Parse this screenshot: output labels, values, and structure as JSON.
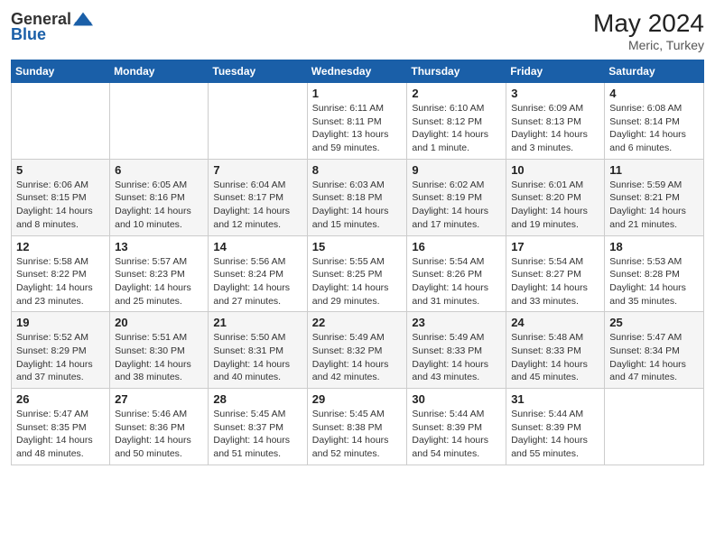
{
  "header": {
    "logo_line1": "General",
    "logo_line2": "Blue",
    "month_year": "May 2024",
    "location": "Meric, Turkey"
  },
  "days_of_week": [
    "Sunday",
    "Monday",
    "Tuesday",
    "Wednesday",
    "Thursday",
    "Friday",
    "Saturday"
  ],
  "weeks": [
    [
      {
        "num": "",
        "sunrise": "",
        "sunset": "",
        "daylight": ""
      },
      {
        "num": "",
        "sunrise": "",
        "sunset": "",
        "daylight": ""
      },
      {
        "num": "",
        "sunrise": "",
        "sunset": "",
        "daylight": ""
      },
      {
        "num": "1",
        "sunrise": "Sunrise: 6:11 AM",
        "sunset": "Sunset: 8:11 PM",
        "daylight": "Daylight: 13 hours and 59 minutes."
      },
      {
        "num": "2",
        "sunrise": "Sunrise: 6:10 AM",
        "sunset": "Sunset: 8:12 PM",
        "daylight": "Daylight: 14 hours and 1 minute."
      },
      {
        "num": "3",
        "sunrise": "Sunrise: 6:09 AM",
        "sunset": "Sunset: 8:13 PM",
        "daylight": "Daylight: 14 hours and 3 minutes."
      },
      {
        "num": "4",
        "sunrise": "Sunrise: 6:08 AM",
        "sunset": "Sunset: 8:14 PM",
        "daylight": "Daylight: 14 hours and 6 minutes."
      }
    ],
    [
      {
        "num": "5",
        "sunrise": "Sunrise: 6:06 AM",
        "sunset": "Sunset: 8:15 PM",
        "daylight": "Daylight: 14 hours and 8 minutes."
      },
      {
        "num": "6",
        "sunrise": "Sunrise: 6:05 AM",
        "sunset": "Sunset: 8:16 PM",
        "daylight": "Daylight: 14 hours and 10 minutes."
      },
      {
        "num": "7",
        "sunrise": "Sunrise: 6:04 AM",
        "sunset": "Sunset: 8:17 PM",
        "daylight": "Daylight: 14 hours and 12 minutes."
      },
      {
        "num": "8",
        "sunrise": "Sunrise: 6:03 AM",
        "sunset": "Sunset: 8:18 PM",
        "daylight": "Daylight: 14 hours and 15 minutes."
      },
      {
        "num": "9",
        "sunrise": "Sunrise: 6:02 AM",
        "sunset": "Sunset: 8:19 PM",
        "daylight": "Daylight: 14 hours and 17 minutes."
      },
      {
        "num": "10",
        "sunrise": "Sunrise: 6:01 AM",
        "sunset": "Sunset: 8:20 PM",
        "daylight": "Daylight: 14 hours and 19 minutes."
      },
      {
        "num": "11",
        "sunrise": "Sunrise: 5:59 AM",
        "sunset": "Sunset: 8:21 PM",
        "daylight": "Daylight: 14 hours and 21 minutes."
      }
    ],
    [
      {
        "num": "12",
        "sunrise": "Sunrise: 5:58 AM",
        "sunset": "Sunset: 8:22 PM",
        "daylight": "Daylight: 14 hours and 23 minutes."
      },
      {
        "num": "13",
        "sunrise": "Sunrise: 5:57 AM",
        "sunset": "Sunset: 8:23 PM",
        "daylight": "Daylight: 14 hours and 25 minutes."
      },
      {
        "num": "14",
        "sunrise": "Sunrise: 5:56 AM",
        "sunset": "Sunset: 8:24 PM",
        "daylight": "Daylight: 14 hours and 27 minutes."
      },
      {
        "num": "15",
        "sunrise": "Sunrise: 5:55 AM",
        "sunset": "Sunset: 8:25 PM",
        "daylight": "Daylight: 14 hours and 29 minutes."
      },
      {
        "num": "16",
        "sunrise": "Sunrise: 5:54 AM",
        "sunset": "Sunset: 8:26 PM",
        "daylight": "Daylight: 14 hours and 31 minutes."
      },
      {
        "num": "17",
        "sunrise": "Sunrise: 5:54 AM",
        "sunset": "Sunset: 8:27 PM",
        "daylight": "Daylight: 14 hours and 33 minutes."
      },
      {
        "num": "18",
        "sunrise": "Sunrise: 5:53 AM",
        "sunset": "Sunset: 8:28 PM",
        "daylight": "Daylight: 14 hours and 35 minutes."
      }
    ],
    [
      {
        "num": "19",
        "sunrise": "Sunrise: 5:52 AM",
        "sunset": "Sunset: 8:29 PM",
        "daylight": "Daylight: 14 hours and 37 minutes."
      },
      {
        "num": "20",
        "sunrise": "Sunrise: 5:51 AM",
        "sunset": "Sunset: 8:30 PM",
        "daylight": "Daylight: 14 hours and 38 minutes."
      },
      {
        "num": "21",
        "sunrise": "Sunrise: 5:50 AM",
        "sunset": "Sunset: 8:31 PM",
        "daylight": "Daylight: 14 hours and 40 minutes."
      },
      {
        "num": "22",
        "sunrise": "Sunrise: 5:49 AM",
        "sunset": "Sunset: 8:32 PM",
        "daylight": "Daylight: 14 hours and 42 minutes."
      },
      {
        "num": "23",
        "sunrise": "Sunrise: 5:49 AM",
        "sunset": "Sunset: 8:33 PM",
        "daylight": "Daylight: 14 hours and 43 minutes."
      },
      {
        "num": "24",
        "sunrise": "Sunrise: 5:48 AM",
        "sunset": "Sunset: 8:33 PM",
        "daylight": "Daylight: 14 hours and 45 minutes."
      },
      {
        "num": "25",
        "sunrise": "Sunrise: 5:47 AM",
        "sunset": "Sunset: 8:34 PM",
        "daylight": "Daylight: 14 hours and 47 minutes."
      }
    ],
    [
      {
        "num": "26",
        "sunrise": "Sunrise: 5:47 AM",
        "sunset": "Sunset: 8:35 PM",
        "daylight": "Daylight: 14 hours and 48 minutes."
      },
      {
        "num": "27",
        "sunrise": "Sunrise: 5:46 AM",
        "sunset": "Sunset: 8:36 PM",
        "daylight": "Daylight: 14 hours and 50 minutes."
      },
      {
        "num": "28",
        "sunrise": "Sunrise: 5:45 AM",
        "sunset": "Sunset: 8:37 PM",
        "daylight": "Daylight: 14 hours and 51 minutes."
      },
      {
        "num": "29",
        "sunrise": "Sunrise: 5:45 AM",
        "sunset": "Sunset: 8:38 PM",
        "daylight": "Daylight: 14 hours and 52 minutes."
      },
      {
        "num": "30",
        "sunrise": "Sunrise: 5:44 AM",
        "sunset": "Sunset: 8:39 PM",
        "daylight": "Daylight: 14 hours and 54 minutes."
      },
      {
        "num": "31",
        "sunrise": "Sunrise: 5:44 AM",
        "sunset": "Sunset: 8:39 PM",
        "daylight": "Daylight: 14 hours and 55 minutes."
      },
      {
        "num": "",
        "sunrise": "",
        "sunset": "",
        "daylight": ""
      }
    ]
  ]
}
